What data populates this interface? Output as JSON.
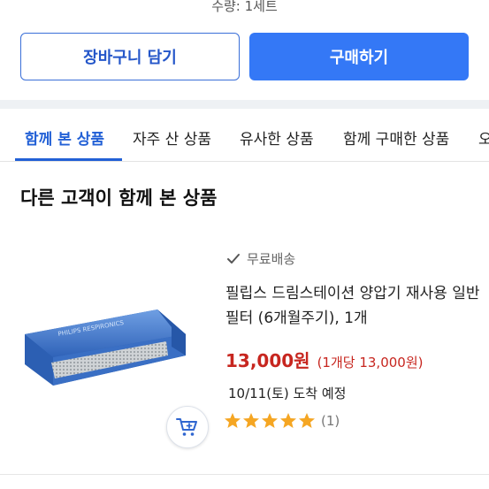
{
  "quantity_text": "수량: 1세트",
  "buttons": {
    "add_to_cart": "장바구니 담기",
    "buy": "구매하기"
  },
  "tabs": [
    {
      "label": "함께 본 상품",
      "active": true
    },
    {
      "label": "자주 산 상품",
      "active": false
    },
    {
      "label": "유사한 상품",
      "active": false
    },
    {
      "label": "함께 구매한 상품",
      "active": false
    },
    {
      "label": "오",
      "active": false
    }
  ],
  "section_title": "다른 고객이 함께 본 상품",
  "product": {
    "shipping_badge": "무료배송",
    "title": "필립스 드림스테이션 양압기 재사용 일반 필터 (6개월주기), 1개",
    "price": "13,000원",
    "unit_price": "(1개당 13,000원)",
    "delivery": "10/11(토) 도착 예정",
    "rating_stars": 5,
    "review_count": "(1)",
    "image_brand_text": "PHILIPS RESPIRONICS"
  },
  "colors": {
    "accent": "#3478f6",
    "tab_active": "#2260d6",
    "price": "#c7261f",
    "star": "#f5a623"
  },
  "icons": {
    "shipping": "check-icon",
    "rating": "star-icon",
    "cart": "cart-plus-icon"
  }
}
